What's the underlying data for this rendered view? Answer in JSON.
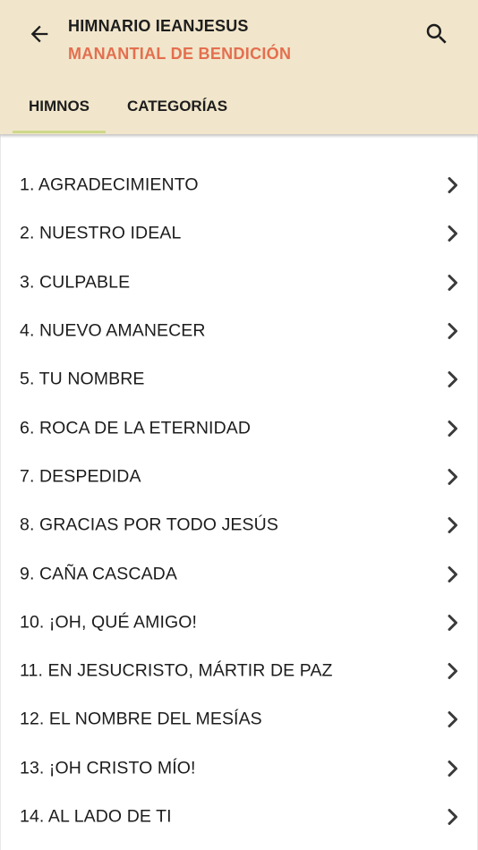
{
  "header": {
    "title": "HIMNARIO IEANJESUS",
    "subtitle": "MANANTIAL DE BENDICIÓN",
    "back_icon": "arrow-left-icon",
    "search_icon": "search-icon",
    "subtitle_color": "#e36f4f",
    "background_color": "#f1e6cb"
  },
  "tabs": [
    {
      "label": "HIMNOS",
      "selected": true
    },
    {
      "label": "CATEGORÍAS",
      "selected": false
    }
  ],
  "hymns": [
    "1. AGRADECIMIENTO",
    "2. NUESTRO IDEAL",
    "3. CULPABLE",
    "4. NUEVO AMANECER",
    "5. TU NOMBRE",
    "6. ROCA DE LA ETERNIDAD",
    "7. DESPEDIDA",
    "8. GRACIAS POR TODO JESÚS",
    "9. CAÑA CASCADA",
    "10. ¡OH, QUÉ AMIGO!",
    "11. EN JESUCRISTO, MÁRTIR DE PAZ",
    "12. EL NOMBRE DEL MESÍAS",
    "13. ¡OH CRISTO MÍO!",
    "14. AL LADO DE TI"
  ]
}
